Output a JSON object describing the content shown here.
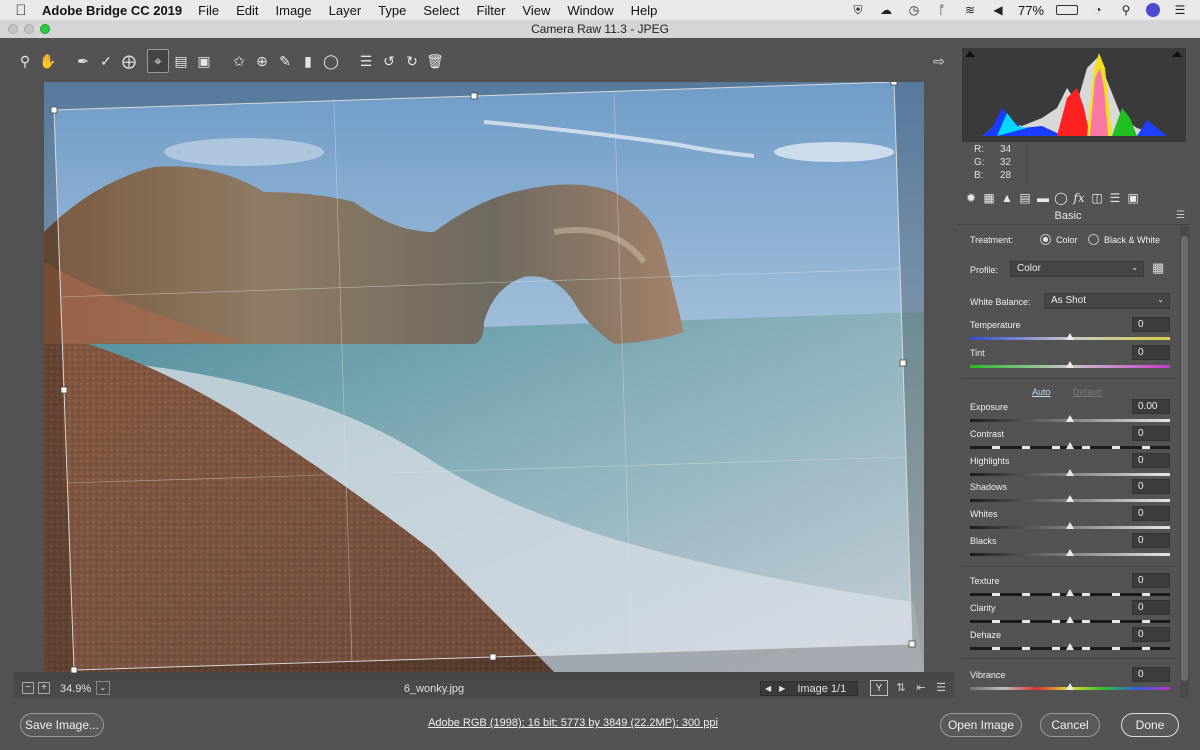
{
  "menubar": {
    "app_name": "Adobe Bridge CC 2019",
    "items": [
      "File",
      "Edit",
      "Image",
      "Layer",
      "Type",
      "Select",
      "Filter",
      "View",
      "Window",
      "Help"
    ],
    "battery": "77%",
    "status_icons": [
      "shield-icon",
      "cloud-icon",
      "time-machine-icon",
      "bluetooth-icon",
      "wifi-icon",
      "volume-icon",
      "battery-icon",
      "clock-icon",
      "search-icon",
      "siri-icon",
      "menu-icon"
    ]
  },
  "window": {
    "title": "Camera Raw 11.3  -  JPEG"
  },
  "toolbar": {
    "tools": [
      "zoom-tool",
      "hand-tool",
      "white-balance-tool",
      "color-sampler-tool",
      "targeted-adjustment-tool",
      "crop-tool",
      "straighten-tool",
      "transform-tool",
      "spot-removal-tool",
      "red-eye-removal-tool",
      "adjustment-brush-tool",
      "graduated-filter-tool",
      "radial-filter-tool",
      "preferences-tool",
      "rotate-ccw-tool",
      "rotate-cw-tool",
      "trash-tool"
    ]
  },
  "statusbar": {
    "zoom": "34.9%",
    "filename": "6_wonky.jpg",
    "image_counter": "Image 1/1"
  },
  "bottombar": {
    "save_label": "Save Image...",
    "workflow": "Adobe RGB (1998); 16 bit; 5773 by 3849 (22.2MP); 300 ppi",
    "open_label": "Open Image",
    "cancel_label": "Cancel",
    "done_label": "Done"
  },
  "histogram": {
    "r_label": "R:",
    "r": "34",
    "g_label": "G:",
    "g": "32",
    "b_label": "B:",
    "b": "28"
  },
  "panel": {
    "title": "Basic",
    "tabs": [
      "aperture-icon",
      "grid-icon",
      "mountains-icon",
      "split-toning-icon",
      "hsl-icon",
      "lens-icon",
      "fx-icon",
      "camera-calibration-icon",
      "presets-icon",
      "snapshots-icon"
    ],
    "treatment_label": "Treatment:",
    "treatment_color": "Color",
    "treatment_bw": "Black & White",
    "profile_label": "Profile:",
    "profile_value": "Color",
    "wb_label": "White Balance:",
    "wb_value": "As Shot",
    "auto": "Auto",
    "default": "Default",
    "sliders": [
      {
        "label": "Temperature",
        "value": "0",
        "fraction": 0.5
      },
      {
        "label": "Tint",
        "value": "0",
        "fraction": 0.5
      },
      {
        "label": "Exposure",
        "value": "0.00",
        "fraction": 0.5
      },
      {
        "label": "Contrast",
        "value": "0",
        "fraction": 0.5
      },
      {
        "label": "Highlights",
        "value": "0",
        "fraction": 0.5
      },
      {
        "label": "Shadows",
        "value": "0",
        "fraction": 0.5
      },
      {
        "label": "Whites",
        "value": "0",
        "fraction": 0.5
      },
      {
        "label": "Blacks",
        "value": "0",
        "fraction": 0.5
      },
      {
        "label": "Texture",
        "value": "0",
        "fraction": 0.5
      },
      {
        "label": "Clarity",
        "value": "0",
        "fraction": 0.5
      },
      {
        "label": "Dehaze",
        "value": "0",
        "fraction": 0.5
      },
      {
        "label": "Vibrance",
        "value": "0",
        "fraction": 0.5
      }
    ]
  },
  "colors": {
    "panel_bg": "#535353",
    "menubar_bg": "#e9e9ea",
    "accent_link": "#c8d8f0"
  }
}
